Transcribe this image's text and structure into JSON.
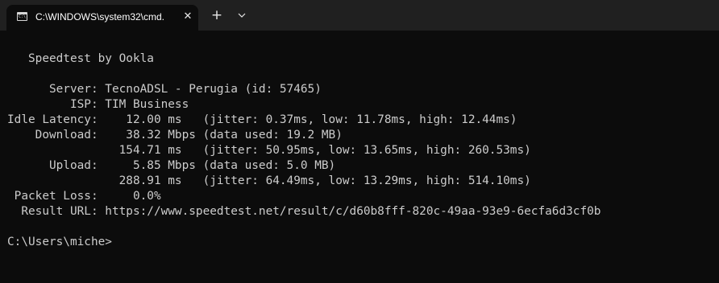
{
  "tab": {
    "title": "C:\\WINDOWS\\system32\\cmd.",
    "icon_prompt": "C:\\",
    "close_label": "✕"
  },
  "toolbar": {
    "new_tab_label": "+"
  },
  "terminal": {
    "lines": [
      "   Speedtest by Ookla",
      "",
      "      Server: TecnoADSL - Perugia (id: 57465)",
      "         ISP: TIM Business",
      "Idle Latency:    12.00 ms   (jitter: 0.37ms, low: 11.78ms, high: 12.44ms)",
      "    Download:    38.32 Mbps (data used: 19.2 MB)",
      "                154.71 ms   (jitter: 50.95ms, low: 13.65ms, high: 260.53ms)",
      "      Upload:     5.85 Mbps (data used: 5.0 MB)",
      "                288.91 ms   (jitter: 64.49ms, low: 13.29ms, high: 514.10ms)",
      " Packet Loss:     0.0%",
      "  Result URL: https://www.speedtest.net/result/c/d60b8fff-820c-49aa-93e9-6ecfa6d3cf0b",
      "",
      "C:\\Users\\miche>"
    ]
  }
}
